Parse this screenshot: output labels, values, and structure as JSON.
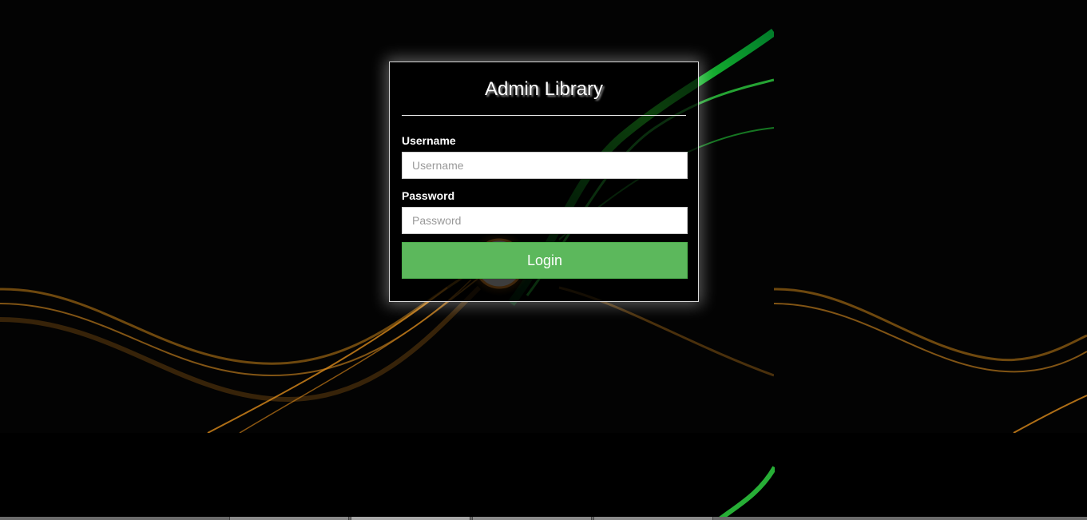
{
  "login": {
    "title": "Admin Library",
    "username_label": "Username",
    "username_placeholder": "Username",
    "username_value": "",
    "password_label": "Password",
    "password_placeholder": "Password",
    "password_value": "",
    "submit_label": "Login"
  },
  "colors": {
    "background": "#000000",
    "button": "#5cb85c",
    "accent_green": "#3bd23b",
    "accent_orange": "#d98a1c"
  },
  "taskbar": {
    "tabs": [
      "",
      "",
      "",
      ""
    ]
  }
}
